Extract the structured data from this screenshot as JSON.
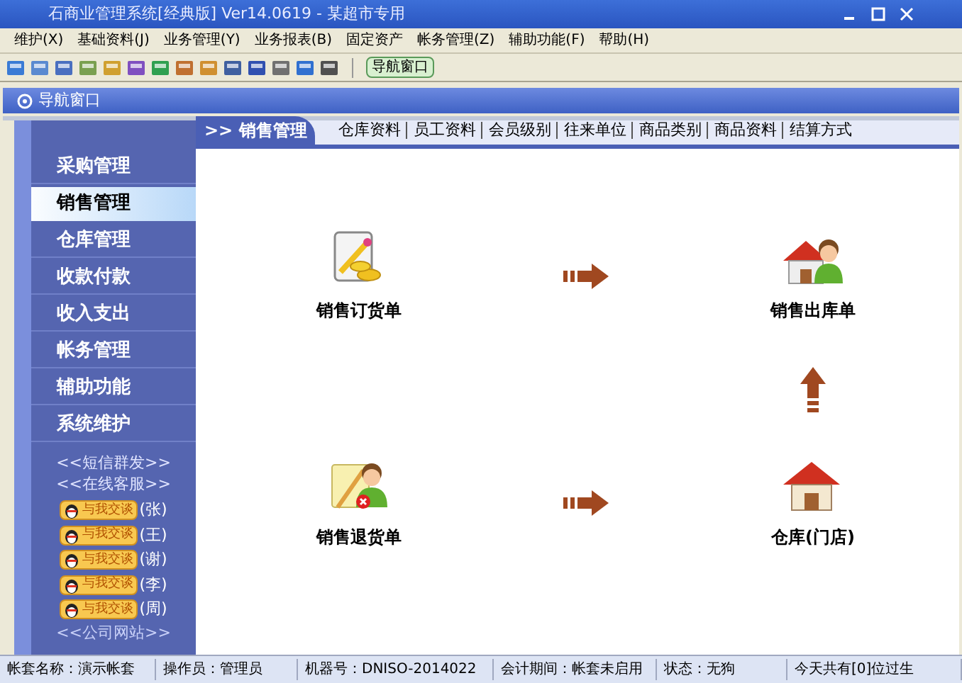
{
  "window": {
    "title": "石商业管理系统[经典版] Ver14.0619 - 某超市专用"
  },
  "menu": [
    "维护(X)",
    "基础资料(J)",
    "业务管理(Y)",
    "业务报表(B)",
    "固定资产",
    "帐务管理(Z)",
    "辅助功能(F)",
    "帮助(H)"
  ],
  "toolbar": {
    "button": "导航窗口"
  },
  "nav_window": {
    "title": "导航窗口"
  },
  "sidebar": {
    "items": [
      {
        "label": "采购管理",
        "selected": false
      },
      {
        "label": "销售管理",
        "selected": true
      },
      {
        "label": "仓库管理",
        "selected": false
      },
      {
        "label": "收款付款",
        "selected": false
      },
      {
        "label": "收入支出",
        "selected": false
      },
      {
        "label": "帐务管理",
        "selected": false
      },
      {
        "label": "辅助功能",
        "selected": false
      },
      {
        "label": "系统维护",
        "selected": false
      }
    ],
    "links": [
      "<<短信群发>>",
      "<<在线客服>>"
    ],
    "chat_buttons": [
      {
        "label": "与我交谈",
        "person": "(张)"
      },
      {
        "label": "与我交谈",
        "person": "(王)"
      },
      {
        "label": "与我交谈",
        "person": "(谢)"
      },
      {
        "label": "与我交谈",
        "person": "(李)"
      },
      {
        "label": "与我交谈",
        "person": "(周)"
      }
    ],
    "footer_link": "<<公司网站>>"
  },
  "header": {
    "section": ">> 销售管理",
    "links": [
      "仓库资料",
      "员工资料",
      "会员级别",
      "往来单位",
      "商品类别",
      "商品资料",
      "结算方式"
    ]
  },
  "flow": {
    "nodes": [
      {
        "kind": "order",
        "label": "销售订货单"
      },
      {
        "kind": "delivery",
        "label": "销售出库单"
      },
      {
        "kind": "return",
        "label": "销售退货单"
      },
      {
        "kind": "warehouse",
        "label": "仓库(门店)"
      }
    ],
    "arrows": [
      {
        "kind": "right"
      },
      {
        "kind": "up"
      },
      {
        "kind": "right"
      }
    ]
  },
  "status_bar": [
    "帐套名称：演示帐套",
    "操作员：管理员",
    "机器号：DNISO-2014022",
    "会计期间：帐套未启用",
    "状态：无狗",
    "今天共有[0]位过生"
  ]
}
